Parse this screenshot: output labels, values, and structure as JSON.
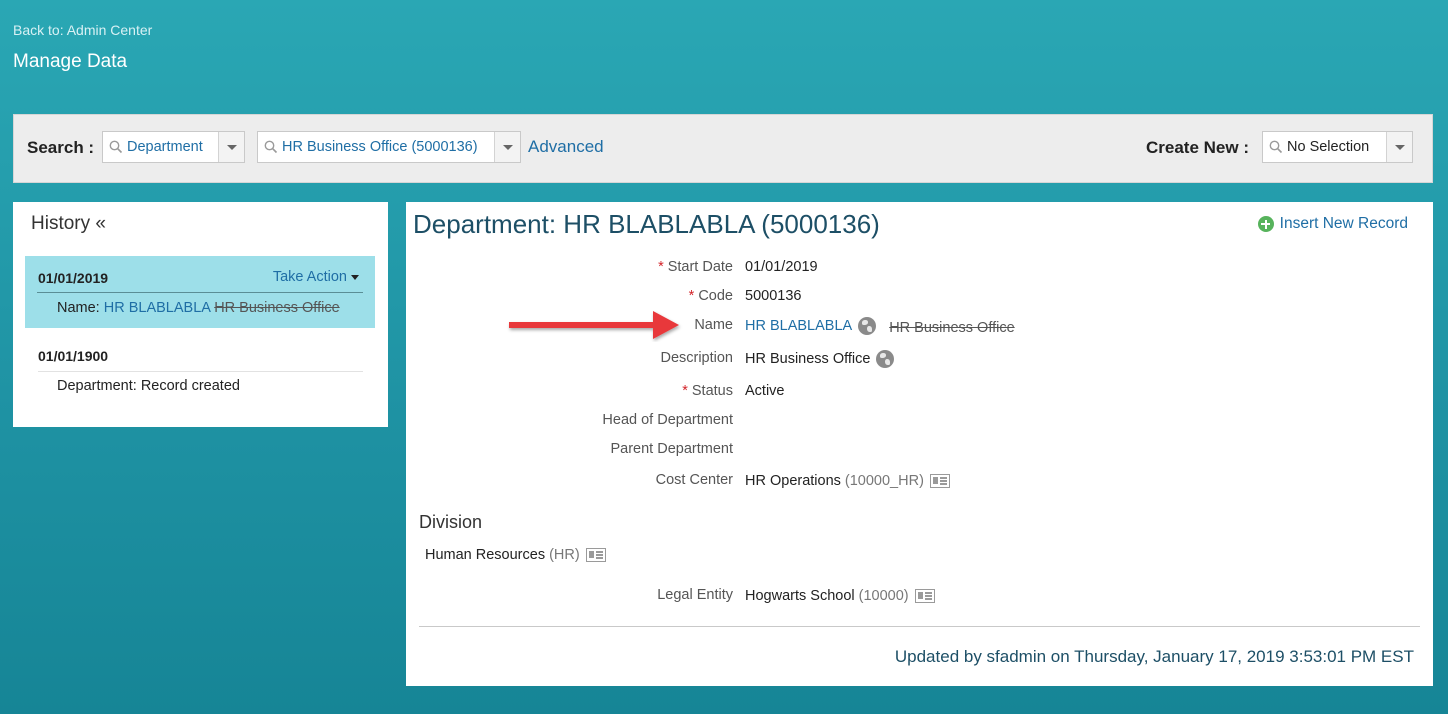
{
  "header": {
    "back_link": "Back to: Admin Center",
    "title": "Manage Data"
  },
  "search": {
    "label": "Search :",
    "type_value": "Department",
    "record_value": "HR Business Office (5000136)",
    "advanced_label": "Advanced",
    "create_label": "Create New :",
    "create_value": "No Selection"
  },
  "history": {
    "title": "History «",
    "entries": [
      {
        "date": "01/01/2019",
        "action_label": "Take Action",
        "change_label": "Name:",
        "new_value": "HR BLABLABLA",
        "old_value": "HR Business Office"
      },
      {
        "date": "01/01/1900",
        "change_text": "Department: Record created"
      }
    ]
  },
  "record": {
    "title": "Department: HR BLABLABLA (5000136)",
    "insert_label": "Insert New Record",
    "fields": {
      "start_date": {
        "label": "Start Date",
        "value": "01/01/2019"
      },
      "code": {
        "label": "Code",
        "value": "5000136"
      },
      "name": {
        "label": "Name",
        "value": "HR BLABLABLA",
        "old_value": "HR Business Office"
      },
      "description": {
        "label": "Description",
        "value": "HR Business Office"
      },
      "status": {
        "label": "Status",
        "value": "Active"
      },
      "head_of_department": {
        "label": "Head of Department",
        "value": ""
      },
      "parent_department": {
        "label": "Parent Department",
        "value": ""
      },
      "cost_center": {
        "label": "Cost Center",
        "value": "HR Operations",
        "code": "(10000_HR)"
      },
      "legal_entity": {
        "label": "Legal Entity",
        "value": "Hogwarts School",
        "code": "(10000)"
      }
    },
    "division": {
      "title": "Division",
      "value": "Human Resources",
      "code": "(HR)"
    },
    "updated_text": "Updated by sfadmin on Thursday, January 17, 2019 3:53:01 PM EST"
  },
  "required_mark": "*",
  "colors": {
    "background": "#1f93a4",
    "link": "#1f6ea5",
    "active_history": "#9ddfe9",
    "required": "#d3242a",
    "arrow": "#e8373a"
  },
  "icons": [
    "search-icon",
    "chevron-down-icon",
    "plus-circle-icon",
    "globe-icon",
    "card-icon",
    "arrow-annotation"
  ]
}
